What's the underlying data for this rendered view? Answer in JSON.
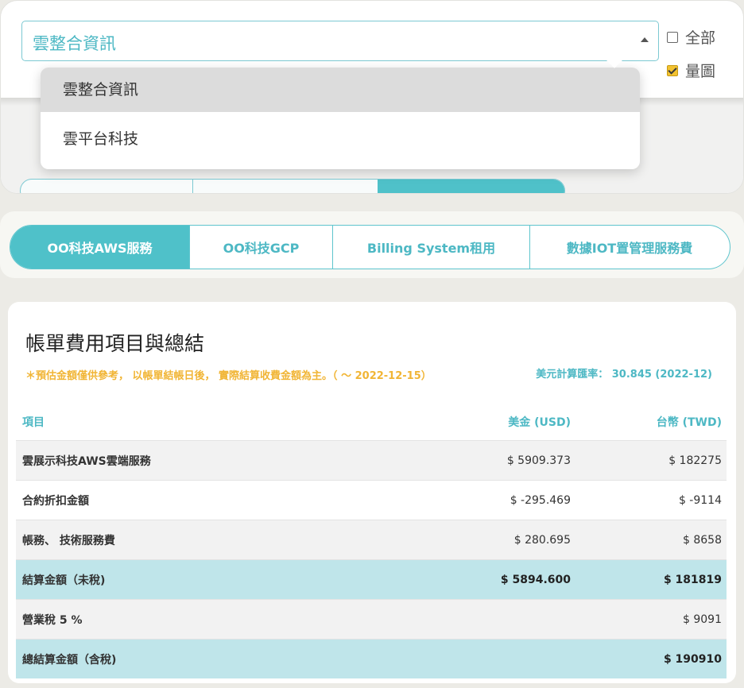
{
  "company_select": {
    "value": "雲整合資訊",
    "options": [
      "雲整合資訊",
      "雲平台科技"
    ],
    "selected_index": 0
  },
  "checkboxes": [
    {
      "label": "全部",
      "checked": false
    },
    {
      "label": "量圖",
      "checked": true
    }
  ],
  "tabs": [
    {
      "label": "OO科技AWS服務",
      "active": true
    },
    {
      "label": "OO科技GCP",
      "active": false
    },
    {
      "label": "Billing System租用",
      "active": false
    },
    {
      "label": "數據IOT置管理服務費",
      "active": false
    }
  ],
  "summary": {
    "title": "帳單費用項目與總結",
    "note": "＊預估金額僅供參考， 以帳單結帳日後， 實際結算收費金額為主。（ ～ 2022-12-15）",
    "rate_label": "美元計算匯率： 30.845 (2022-12)",
    "headers": {
      "item": "項目",
      "usd": "美金 (USD)",
      "twd": "台幣 (TWD)"
    },
    "rows": [
      {
        "item": "雲展示科技AWS雲端服務",
        "usd": "$ 5909.373",
        "twd": "$ 182275",
        "style": "grey"
      },
      {
        "item": "合約折扣金額",
        "usd": "$ -295.469",
        "twd": "$ -9114",
        "style": "white"
      },
      {
        "item": "帳務、 技術服務費",
        "usd": "$ 280.695",
        "twd": "$ 8658",
        "style": "grey"
      },
      {
        "item": "結算金額（未稅)",
        "usd": "$ 5894.600",
        "twd": "$ 181819",
        "style": "teal"
      },
      {
        "item": "營業稅 5 %",
        "usd": "",
        "twd": "$ 9091",
        "style": "grey"
      },
      {
        "item": "總結算金額（含稅)",
        "usd": "",
        "twd": "$ 190910",
        "style": "teal"
      }
    ]
  },
  "colors": {
    "accent": "#4fc1c9",
    "accent_text": "#4db8c4",
    "note": "#f1b535",
    "total_row": "#bfe5ea"
  }
}
